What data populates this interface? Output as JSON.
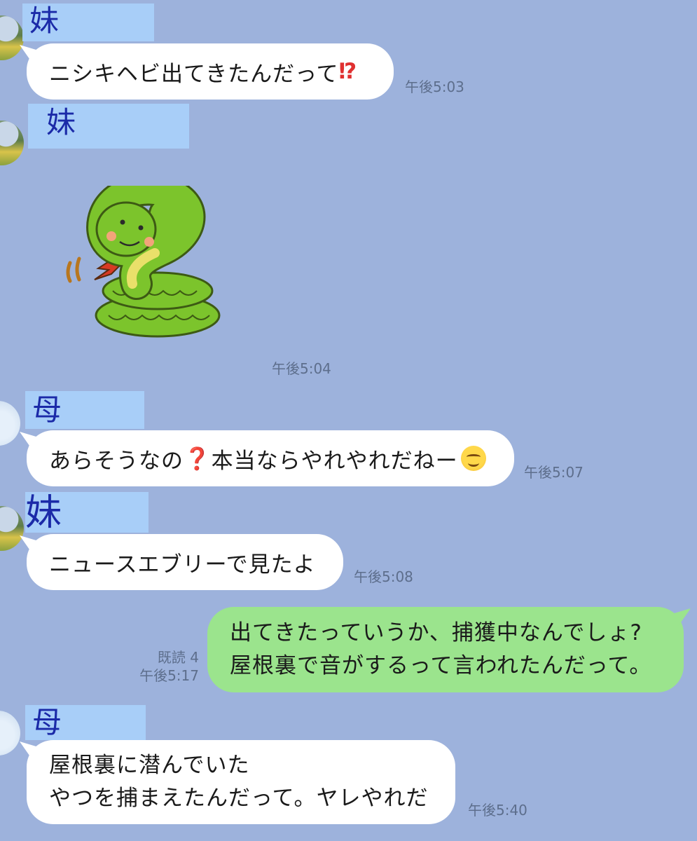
{
  "messages": [
    {
      "sender_label": "妹",
      "text": "ニシキヘビ出てきたんだって",
      "emoji": "⁉",
      "time": "午後5:03"
    },
    {
      "sender_label": "妹",
      "sticker": "snake-sticker",
      "time": "午後5:04"
    },
    {
      "sender_label": "母",
      "text_before": "あらそうなの",
      "emoji": "❓",
      "text_after": "本当ならやれやれだねー",
      "emoji2": "smiling-face",
      "time": "午後5:07"
    },
    {
      "sender_label": "妹",
      "text": "ニュースエブリーで見たよ",
      "time": "午後5:08"
    },
    {
      "sender": "me",
      "lines": [
        "出てきたっていうか、捕獲中なんでしょ?",
        "屋根裏で音がするって言われたんだって。"
      ],
      "read_label": "既読 4",
      "time": "午後5:17"
    },
    {
      "sender_label": "母",
      "lines": [
        "屋根裏に潜んでいた",
        "やつを捕まえたんだって。ヤレやれだ"
      ],
      "time": "午後5:40"
    }
  ],
  "colors": {
    "background": "#9db2dc",
    "incoming_bubble": "#ffffff",
    "outgoing_bubble": "#9be48d",
    "name_highlight": "#a8cef8",
    "name_text": "#1b2aa8"
  }
}
